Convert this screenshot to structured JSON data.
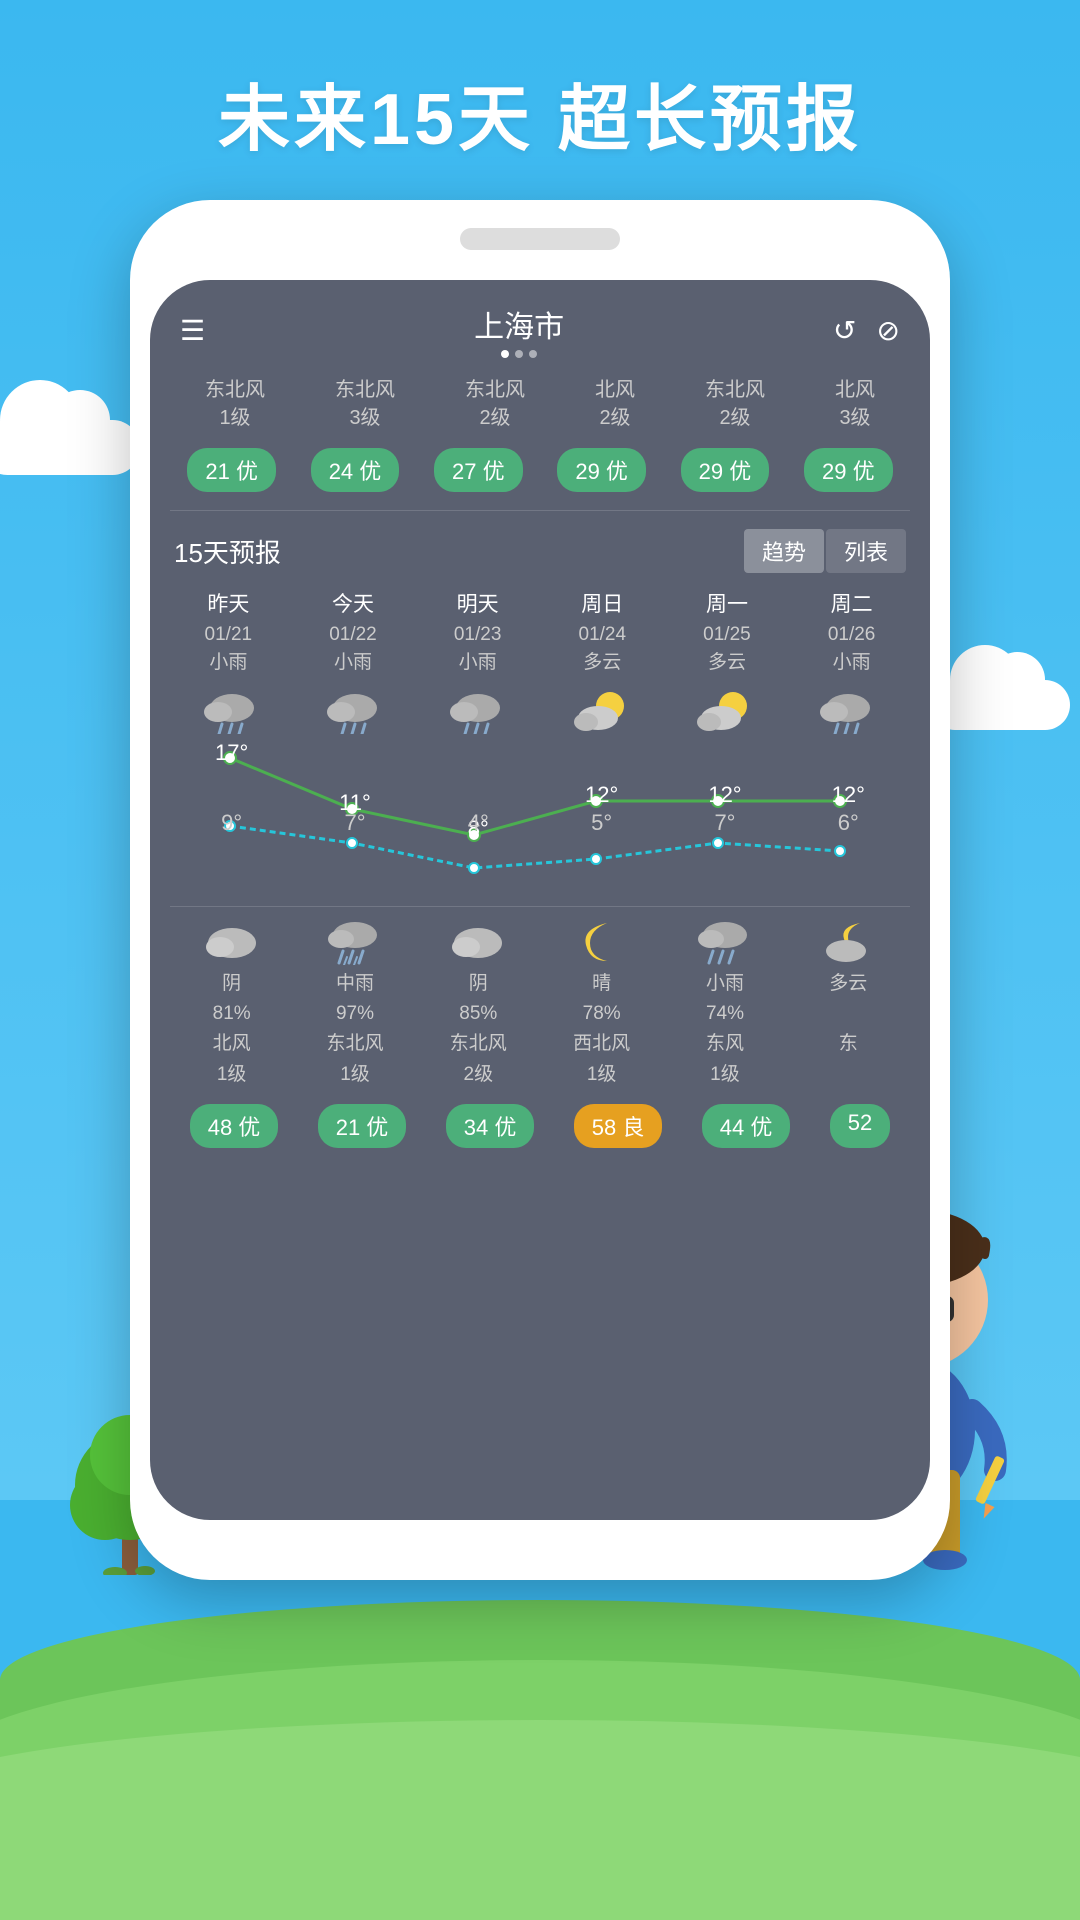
{
  "title": "未来15天  超长预报",
  "background_color": "#3bb8f0",
  "header": {
    "city": "上海市",
    "dots": [
      true,
      false,
      false
    ],
    "menu_label": "☰",
    "crown_label": "♛",
    "refresh_label": "↺",
    "share_label": "⟳"
  },
  "wind_row": [
    {
      "text": "东北风\n1级"
    },
    {
      "text": "东北风\n3级"
    },
    {
      "text": "东北风\n2级"
    },
    {
      "text": "北风\n2级"
    },
    {
      "text": "东北风\n2级"
    },
    {
      "text": "北风\n3级"
    }
  ],
  "aqi_row": [
    {
      "value": "21 优",
      "type": "good"
    },
    {
      "value": "24 优",
      "type": "good"
    },
    {
      "value": "27 优",
      "type": "good"
    },
    {
      "value": "29 优",
      "type": "good"
    },
    {
      "value": "29 优",
      "type": "good"
    },
    {
      "value": "29 优",
      "type": "good"
    }
  ],
  "section_title": "15天预报",
  "tabs": [
    {
      "label": "趋势",
      "active": true
    },
    {
      "label": "列表",
      "active": false
    }
  ],
  "forecast": [
    {
      "day": "昨天",
      "date": "01/21",
      "weather": "小雨",
      "icon": "rain"
    },
    {
      "day": "今天",
      "date": "01/22",
      "weather": "小雨",
      "icon": "rain"
    },
    {
      "day": "明天",
      "date": "01/23",
      "weather": "小雨",
      "icon": "rain"
    },
    {
      "day": "周日",
      "date": "01/24",
      "weather": "多云",
      "icon": "partly-cloudy"
    },
    {
      "day": "周一",
      "date": "01/25",
      "weather": "多云",
      "icon": "partly-cloudy"
    },
    {
      "day": "周二",
      "date": "01/26",
      "weather": "小雨",
      "icon": "rain"
    }
  ],
  "temp_high": [
    "17°",
    "11°",
    "8°",
    "12°",
    "12°",
    "12°"
  ],
  "temp_low": [
    "9°",
    "7°",
    "4°",
    "5°",
    "7°",
    "6°"
  ],
  "bottom_forecast": [
    {
      "icon": "cloudy",
      "desc": "阴",
      "humidity": "81%",
      "wind": "北风",
      "wind_level": "1级"
    },
    {
      "icon": "rain",
      "desc": "中雨",
      "humidity": "97%",
      "wind": "东北风",
      "wind_level": "1级"
    },
    {
      "icon": "cloudy",
      "desc": "阴",
      "humidity": "85%",
      "wind": "东北风",
      "wind_level": "2级"
    },
    {
      "icon": "moon",
      "desc": "晴",
      "humidity": "78%",
      "wind": "西北风",
      "wind_level": "1级"
    },
    {
      "icon": "rain",
      "desc": "小雨",
      "humidity": "74%",
      "wind": "东风",
      "wind_level": "1级"
    },
    {
      "icon": "partly-cloudy",
      "desc": "多云",
      "humidity": "",
      "wind": "东",
      "wind_level": ""
    }
  ],
  "bottom_aqi": [
    {
      "value": "48 优",
      "type": "good"
    },
    {
      "value": "21 优",
      "type": "good"
    },
    {
      "value": "34 优",
      "type": "good"
    },
    {
      "value": "58 良",
      "type": "moderate"
    },
    {
      "value": "44 优",
      "type": "good"
    },
    {
      "value": "52",
      "type": "good"
    }
  ]
}
